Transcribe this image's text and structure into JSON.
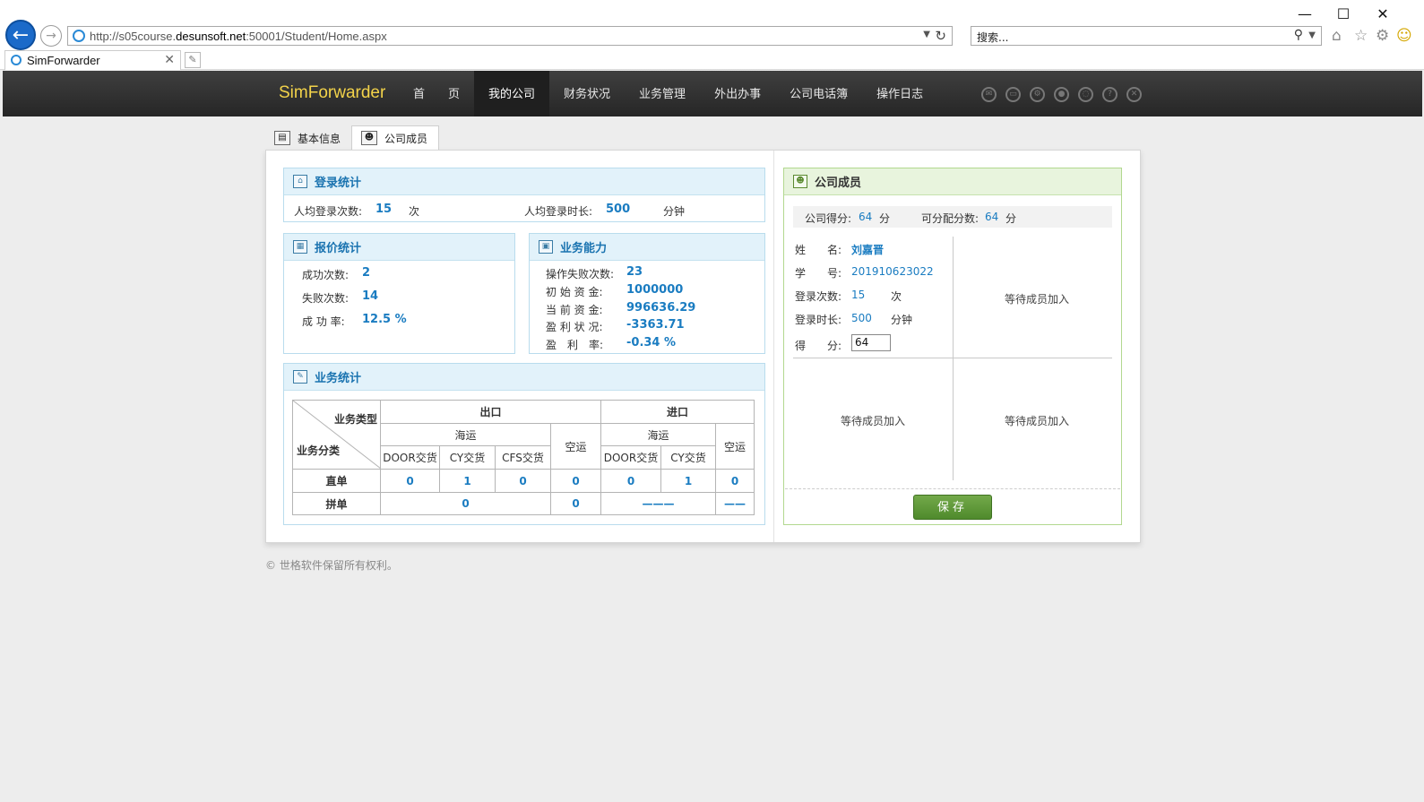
{
  "browser": {
    "url_prefix": "http://s05course.",
    "url_domain": "desunsoft.net",
    "url_suffix": ":50001/Student/Home.aspx",
    "search_placeholder": "搜索...",
    "tab_title": "SimForwarder"
  },
  "header": {
    "logo": "SimForwarder",
    "nav": [
      "首　　页",
      "我的公司",
      "财务状况",
      "业务管理",
      "外出办事",
      "公司电话簿",
      "操作日志"
    ],
    "active_nav": 1
  },
  "subtabs": [
    "基本信息",
    "公司成员"
  ],
  "login_stats": {
    "title": "登录统计",
    "avg_logins_label": "人均登录次数:",
    "avg_logins": "15",
    "avg_logins_unit": "次",
    "avg_duration_label": "人均登录时长:",
    "avg_duration": "500",
    "avg_duration_unit": "分钟"
  },
  "quote_stats": {
    "title": "报价统计",
    "success_label": "成功次数:",
    "success": "2",
    "fail_label": "失败次数:",
    "fail": "14",
    "rate_label": "成 功 率:",
    "rate": "12.5 %"
  },
  "business_ability": {
    "title": "业务能力",
    "op_fail_label": "操作失败次数:",
    "op_fail": "23",
    "init_fund_label": "初 始 资 金:",
    "init_fund": "1000000",
    "cur_fund_label": "当 前 资 金:",
    "cur_fund": "996636.29",
    "profit_label": "盈 利 状 况:",
    "profit": "-3363.71",
    "profit_rate_label": "盈　利　率:",
    "profit_rate": "-0.34 %"
  },
  "business_stats": {
    "title": "业务统计",
    "corner_type": "业务类型",
    "corner_class": "业务分类",
    "export": "出口",
    "import": "进口",
    "sea": "海运",
    "air": "空运",
    "door": "DOOR交货",
    "cy": "CY交货",
    "cfs": "CFS交货",
    "direct": "直单",
    "consol": "拼单",
    "direct_values": [
      "0",
      "1",
      "0",
      "0",
      "0",
      "1",
      "0"
    ],
    "consol_values": [
      "0",
      "0",
      "———",
      "——"
    ]
  },
  "members": {
    "title": "公司成员",
    "company_score_label": "公司得分:",
    "company_score": "64",
    "score_unit": "分",
    "assignable_label": "可分配分数:",
    "assignable": "64",
    "name_label": "姓　　名:",
    "name": "刘嘉晋",
    "id_label": "学　　号:",
    "id": "201910623022",
    "logins_label": "登录次数:",
    "logins": "15",
    "logins_unit": "次",
    "duration_label": "登录时长:",
    "duration": "500",
    "duration_unit": "分钟",
    "score_label": "得　　分:",
    "score": "64",
    "waiting": "等待成员加入",
    "save": "保存"
  },
  "footer": "© 世格软件保留所有权利。"
}
